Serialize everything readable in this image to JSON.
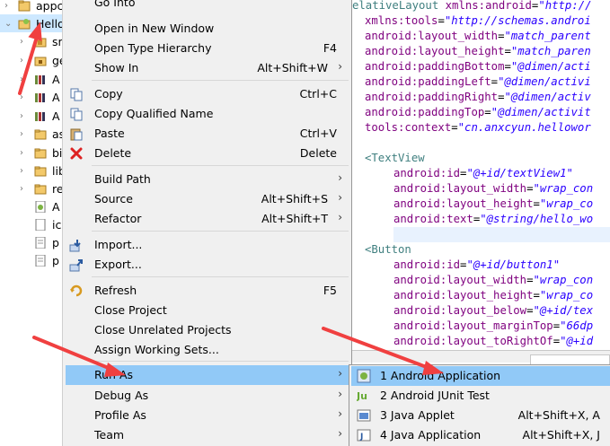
{
  "tree": {
    "items": [
      {
        "label": "appc",
        "expanded": false,
        "icon": "project-icon"
      },
      {
        "label": "Hello",
        "expanded": true,
        "icon": "android-project-icon"
      },
      {
        "label": "sr",
        "expanded": false,
        "icon": "source-folder-icon"
      },
      {
        "label": "ge",
        "expanded": false,
        "icon": "gen-folder-icon"
      },
      {
        "label": "A",
        "expanded": false,
        "icon": "library-icon"
      },
      {
        "label": "A",
        "expanded": false,
        "icon": "library-icon"
      },
      {
        "label": "A",
        "expanded": false,
        "icon": "library-icon"
      },
      {
        "label": "as",
        "expanded": false,
        "icon": "folder-icon"
      },
      {
        "label": "bi",
        "expanded": false,
        "icon": "folder-icon"
      },
      {
        "label": "lib",
        "expanded": false,
        "icon": "folder-icon"
      },
      {
        "label": "re",
        "expanded": false,
        "icon": "folder-icon"
      },
      {
        "label": "A",
        "expanded": false,
        "icon": "manifest-file-icon"
      },
      {
        "label": "ic",
        "expanded": false,
        "icon": "image-file-icon"
      },
      {
        "label": "p",
        "expanded": false,
        "icon": "file-icon"
      },
      {
        "label": "p",
        "expanded": false,
        "icon": "file-icon"
      }
    ]
  },
  "context_menu": {
    "items": [
      {
        "label": "Go Into",
        "shortcut": "",
        "submenu": false
      },
      {
        "label": "Open in New Window",
        "shortcut": "",
        "submenu": false
      },
      {
        "label": "Open Type Hierarchy",
        "shortcut": "F4",
        "submenu": false
      },
      {
        "label": "Show In",
        "shortcut": "Alt+Shift+W",
        "submenu": true
      },
      {
        "label": "Copy",
        "shortcut": "Ctrl+C",
        "submenu": false,
        "icon": "copy-icon"
      },
      {
        "label": "Copy Qualified Name",
        "shortcut": "",
        "submenu": false,
        "icon": "copy-icon"
      },
      {
        "label": "Paste",
        "shortcut": "Ctrl+V",
        "submenu": false,
        "icon": "paste-icon"
      },
      {
        "label": "Delete",
        "shortcut": "Delete",
        "submenu": false,
        "icon": "delete-icon"
      },
      {
        "label": "Build Path",
        "shortcut": "",
        "submenu": true
      },
      {
        "label": "Source",
        "shortcut": "Alt+Shift+S",
        "submenu": true
      },
      {
        "label": "Refactor",
        "shortcut": "Alt+Shift+T",
        "submenu": true
      },
      {
        "label": "Import...",
        "shortcut": "",
        "submenu": false,
        "icon": "import-icon"
      },
      {
        "label": "Export...",
        "shortcut": "",
        "submenu": false,
        "icon": "export-icon"
      },
      {
        "label": "Refresh",
        "shortcut": "F5",
        "submenu": false,
        "icon": "refresh-icon"
      },
      {
        "label": "Close Project",
        "shortcut": "",
        "submenu": false
      },
      {
        "label": "Close Unrelated Projects",
        "shortcut": "",
        "submenu": false
      },
      {
        "label": "Assign Working Sets...",
        "shortcut": "",
        "submenu": false
      },
      {
        "label": "Run As",
        "shortcut": "",
        "submenu": true,
        "active": true
      },
      {
        "label": "Debug As",
        "shortcut": "",
        "submenu": true
      },
      {
        "label": "Profile As",
        "shortcut": "",
        "submenu": true
      },
      {
        "label": "Team",
        "shortcut": "",
        "submenu": true
      }
    ]
  },
  "submenu": {
    "items": [
      {
        "label": "1 Android Application",
        "shortcut": "",
        "icon": "android-app-icon",
        "active": true
      },
      {
        "label": "2 Android JUnit Test",
        "shortcut": "",
        "icon": "junit-icon"
      },
      {
        "label": "3 Java Applet",
        "shortcut": "Alt+Shift+X, A",
        "icon": "applet-icon"
      },
      {
        "label": "4 Java Application",
        "shortcut": "Alt+Shift+X, J",
        "icon": "java-app-icon"
      }
    ]
  },
  "editor": {
    "lines": [
      [
        {
          "t": "tag",
          "s": "elativeLayout "
        },
        {
          "t": "attr",
          "s": "xmlns:android"
        },
        {
          "t": "plain",
          "s": "="
        },
        {
          "t": "val",
          "s": "\"http://"
        }
      ],
      [
        {
          "t": "attr",
          "s": "xmlns:tools"
        },
        {
          "t": "plain",
          "s": "="
        },
        {
          "t": "val",
          "s": "\"http://schemas.androi"
        }
      ],
      [
        {
          "t": "attr",
          "s": "android:layout_width"
        },
        {
          "t": "plain",
          "s": "="
        },
        {
          "t": "val",
          "s": "\"match_parent"
        }
      ],
      [
        {
          "t": "attr",
          "s": "android:layout_height"
        },
        {
          "t": "plain",
          "s": "="
        },
        {
          "t": "val",
          "s": "\"match_paren"
        }
      ],
      [
        {
          "t": "attr",
          "s": "android:paddingBottom"
        },
        {
          "t": "plain",
          "s": "="
        },
        {
          "t": "val",
          "s": "\"@dimen/acti"
        }
      ],
      [
        {
          "t": "attr",
          "s": "android:paddingLeft"
        },
        {
          "t": "plain",
          "s": "="
        },
        {
          "t": "val",
          "s": "\"@dimen/activi"
        }
      ],
      [
        {
          "t": "attr",
          "s": "android:paddingRight"
        },
        {
          "t": "plain",
          "s": "="
        },
        {
          "t": "val",
          "s": "\"@dimen/activ"
        }
      ],
      [
        {
          "t": "attr",
          "s": "android:paddingTop"
        },
        {
          "t": "plain",
          "s": "="
        },
        {
          "t": "val",
          "s": "\"@dimen/activit"
        }
      ],
      [
        {
          "t": "attr",
          "s": "tools:context"
        },
        {
          "t": "plain",
          "s": "="
        },
        {
          "t": "val",
          "s": "\"cn.anxcyun.hellowor"
        }
      ],
      [],
      [
        {
          "t": "tag",
          "s": "<TextView"
        }
      ],
      [
        {
          "t": "attr",
          "s": "android:id"
        },
        {
          "t": "plain",
          "s": "="
        },
        {
          "t": "val",
          "s": "\"@+id/textView1\""
        }
      ],
      [
        {
          "t": "attr",
          "s": "android:layout_width"
        },
        {
          "t": "plain",
          "s": "="
        },
        {
          "t": "val",
          "s": "\"wrap_con"
        }
      ],
      [
        {
          "t": "attr",
          "s": "android:layout_height"
        },
        {
          "t": "plain",
          "s": "="
        },
        {
          "t": "val",
          "s": "\"wrap_co"
        }
      ],
      [
        {
          "t": "attr",
          "s": "android:text"
        },
        {
          "t": "plain",
          "s": "="
        },
        {
          "t": "val",
          "s": "\"@string/hello_wo"
        }
      ],
      [],
      [
        {
          "t": "tag",
          "s": "<Button"
        }
      ],
      [
        {
          "t": "attr",
          "s": "android:id"
        },
        {
          "t": "plain",
          "s": "="
        },
        {
          "t": "val",
          "s": "\"@+id/button1\""
        }
      ],
      [
        {
          "t": "attr",
          "s": "android:layout_width"
        },
        {
          "t": "plain",
          "s": "="
        },
        {
          "t": "val",
          "s": "\"wrap_con"
        }
      ],
      [
        {
          "t": "attr",
          "s": "android:layout_height"
        },
        {
          "t": "plain",
          "s": "="
        },
        {
          "t": "val",
          "s": "\"wrap_co"
        }
      ],
      [
        {
          "t": "attr",
          "s": "android:layout_below"
        },
        {
          "t": "plain",
          "s": "="
        },
        {
          "t": "val",
          "s": "\"@+id/tex"
        }
      ],
      [
        {
          "t": "attr",
          "s": "android:layout_marginTop"
        },
        {
          "t": "plain",
          "s": "="
        },
        {
          "t": "val",
          "s": "\"66dp"
        }
      ],
      [
        {
          "t": "attr",
          "s": "android:layout_toRightOf"
        },
        {
          "t": "plain",
          "s": "="
        },
        {
          "t": "val",
          "s": "\"@+id"
        }
      ]
    ]
  },
  "colors": {
    "menu_bg": "#f0f0f0",
    "menu_highlight": "#91c9f7",
    "arrow_red": "#f04040"
  }
}
